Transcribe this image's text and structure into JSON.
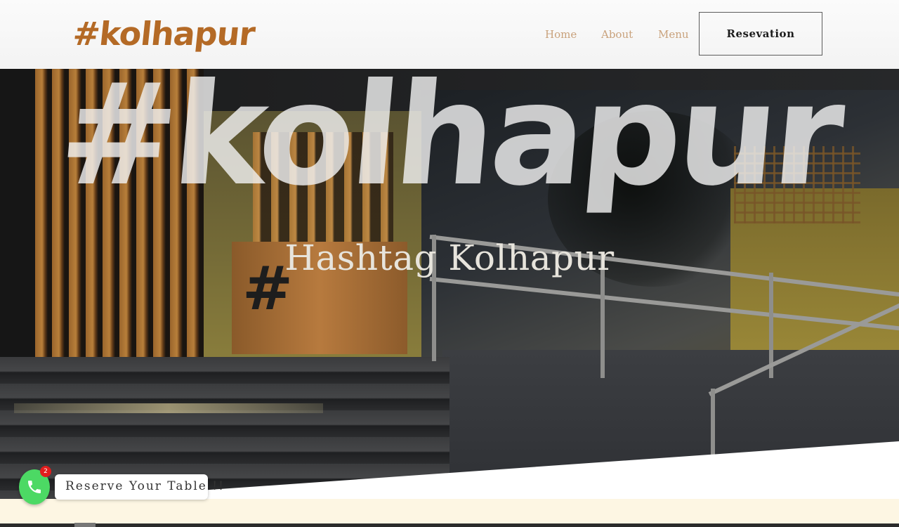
{
  "header": {
    "logo_text": "#kolhapur",
    "nav": [
      {
        "label": "Home"
      },
      {
        "label": "About"
      },
      {
        "label": "Menu"
      }
    ],
    "reservation_button": "Resevation",
    "colors": {
      "logo": "#b46a26",
      "nav": "#c9a27c"
    }
  },
  "hero": {
    "script_title": "#kolhapur",
    "subtitle": "Hashtag Kolhapur",
    "desk_sign": "#"
  },
  "chat_widget": {
    "icon": "whatsapp-phone-icon",
    "badge_count": "2",
    "label": "Reserve Your Table !!",
    "color": "#4cd964"
  }
}
